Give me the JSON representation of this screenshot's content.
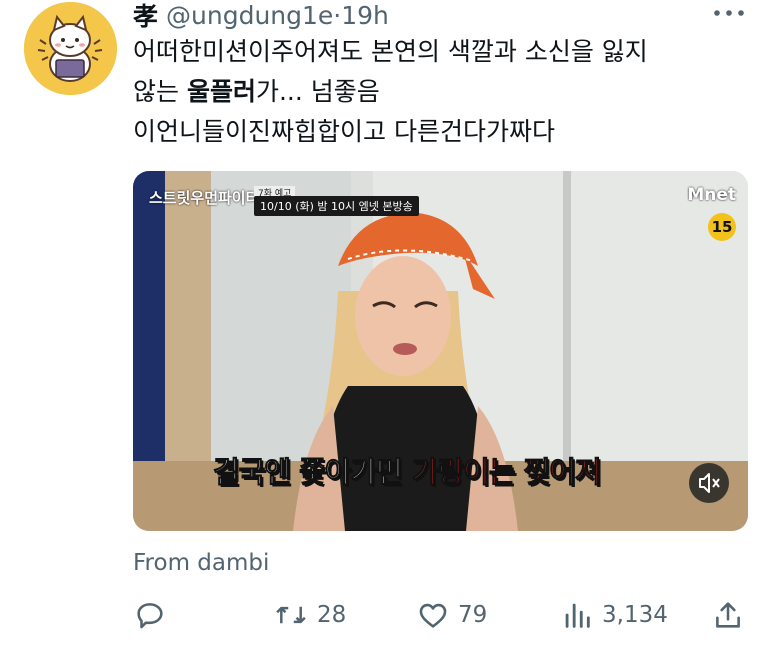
{
  "tweet": {
    "display_name": "孝",
    "handle": "@ungdung1e",
    "separator": "·",
    "time": "19h",
    "text_line1": "어떠한미션이주어져도 본연의 색깔과 소신을 잃지",
    "text_line2_prefix": "않는 ",
    "text_line2_bold": "울플러",
    "text_line2_suffix": "가... 넘좋음",
    "text_line3": "이언니들이진짜힙합이고 다른건다가짜다"
  },
  "media": {
    "show_logo": "스트릿우먼파이터2",
    "episode_badge": "7화 예고",
    "broadcast_info": "10/10 (화) 밤 10시 엠넷 본방송",
    "channel_logo": "Mnet",
    "age_rating": "15",
    "subtitle_white": "결국엔 쫓아가면",
    "subtitle_red": "가랑이는 찢어져"
  },
  "source_label": "From dambi",
  "actions": {
    "reply_count": "",
    "retweet_count": "28",
    "like_count": "79",
    "view_count": "3,134"
  },
  "colors": {
    "text_primary": "#0f1419",
    "text_secondary": "#536471",
    "avatar_bg": "#f4c64a",
    "subtitle_red": "#e8242c"
  },
  "icons": [
    "more-icon",
    "reply-icon",
    "retweet-icon",
    "like-icon",
    "views-icon",
    "share-icon",
    "mute-icon"
  ]
}
